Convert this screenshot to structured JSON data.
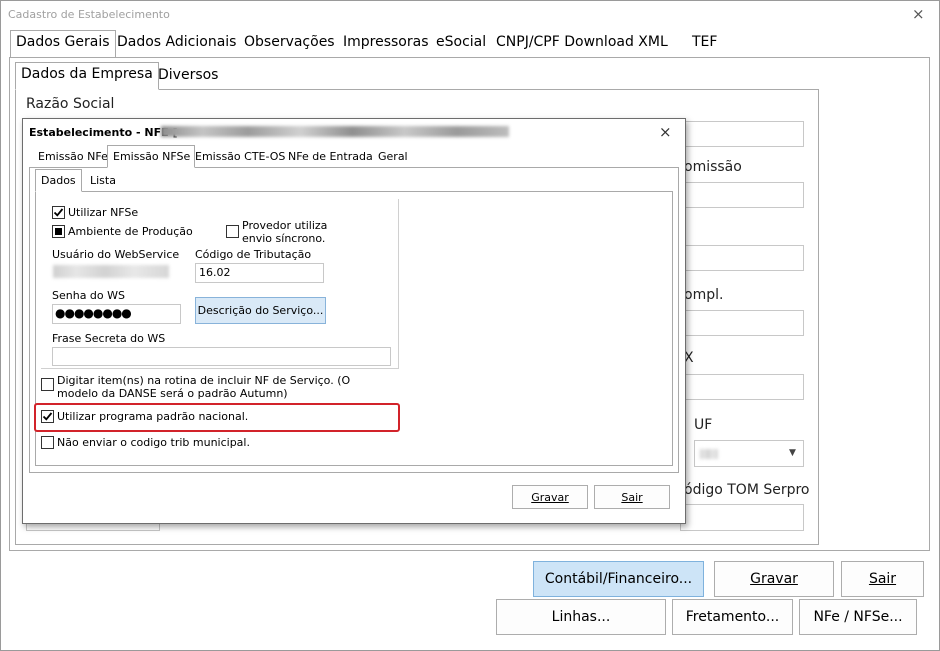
{
  "window": {
    "title": "Cadastro de Estabelecimento",
    "close_icon": "×"
  },
  "main_tabs": [
    "Dados Gerais",
    "Dados Adicionais",
    "Observações",
    "Impressoras",
    "eSocial",
    "CNPJ/CPF Download XML",
    "TEF"
  ],
  "sub_tabs": [
    "Dados da Empresa",
    "Diversos"
  ],
  "form": {
    "razao_social_label": "Razão Social",
    "comissao_label": "omissão",
    "compl_label": "ompl.",
    "x_label": "X",
    "uf_label": "UF",
    "tom_label": "ódigo TOM Serpro"
  },
  "buttons": {
    "contabil": "Contábil/Financeiro...",
    "gravar": "Gravar",
    "sair": "Sair",
    "linhas": "Linhas...",
    "fretamento": "Fretamento...",
    "nfe_nfse": "NFe / NFSe..."
  },
  "dialog": {
    "title": "Estabelecimento - NFE [",
    "close_icon": "×",
    "tabs": [
      "Emissão NFe",
      "Emissão NFSe",
      "Emissão CTE-OS",
      "NFe de Entrada",
      "Geral"
    ],
    "inner_tabs": [
      "Dados",
      "Lista"
    ],
    "utilizar_nfse": "Utilizar NFSe",
    "ambiente_producao": "Ambiente de Produção",
    "provedor_sincrono": "Provedor utiliza envio síncrono.",
    "usuario_ws_label": "Usuário do WebService",
    "codigo_tributacao_label": "Código de Tributação",
    "codigo_tributacao_value": "16.02",
    "senha_ws_label": "Senha do WS",
    "senha_ws_value": "●●●●●●●●",
    "descricao_servico_button": "Descrição do Serviço...",
    "frase_secreta_label": "Frase Secreta do WS",
    "digitar_itens": "Digitar item(ns) na rotina de incluir NF de Serviço. (O modelo da DANSE será o padrão Autumn)",
    "programa_padrao_nacional": "Utilizar programa padrão nacional.",
    "nao_enviar_codigo": "Não enviar o codigo trib municipal.",
    "gravar_button": "Gravar",
    "sair_button": "Sair",
    "checks": {
      "utilizar_nfse": true,
      "ambiente_producao": "indeterminate",
      "provedor_sincrono": false,
      "digitar_itens": false,
      "programa_padrao_nacional": true,
      "nao_enviar_codigo": false
    }
  },
  "colors": {
    "highlight_border": "#d2232a",
    "selected_button": "#cde4f7"
  }
}
